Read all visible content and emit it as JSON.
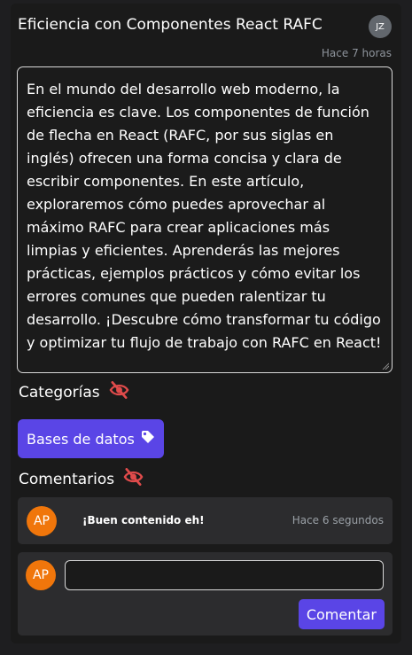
{
  "post": {
    "title": "Eficiencia con Componentes React RAFC",
    "author_initials": "JZ",
    "time": "Hace 7 horas",
    "content": "En el mundo del desarrollo web moderno, la eficiencia es clave. Los componentes de función de flecha en React (RAFC, por sus siglas en inglés) ofrecen una forma concisa y clara de escribir componentes. En este artículo, exploraremos cómo puedes aprovechar al máximo RAFC para crear aplicaciones más limpias y eficientes. Aprenderás las mejores prácticas, ejemplos prácticos y cómo evitar los errores comunes que pueden ralentizar tu desarrollo. ¡Descubre cómo transformar tu código y optimizar tu flujo de trabajo con RAFC en React!"
  },
  "categories": {
    "label": "Categorías",
    "toggle_icon": "eye-slash-icon",
    "items": [
      {
        "label": "Bases de datos",
        "icon": "tag-icon"
      }
    ]
  },
  "comments": {
    "label": "Comentarios",
    "toggle_icon": "eye-slash-icon",
    "items": [
      {
        "initials": "AP",
        "text": "¡Buen contenido eh!",
        "time": "Hace 6 segundos"
      }
    ],
    "new_comment": {
      "initials": "AP",
      "value": "",
      "placeholder": "",
      "submit_label": "Comentar"
    }
  },
  "colors": {
    "background": "#1a1a1a",
    "accent": "#5a45e6",
    "avatar": "#f0760b",
    "icon_red": "#e04b4b",
    "muted_text": "#8e949c"
  }
}
